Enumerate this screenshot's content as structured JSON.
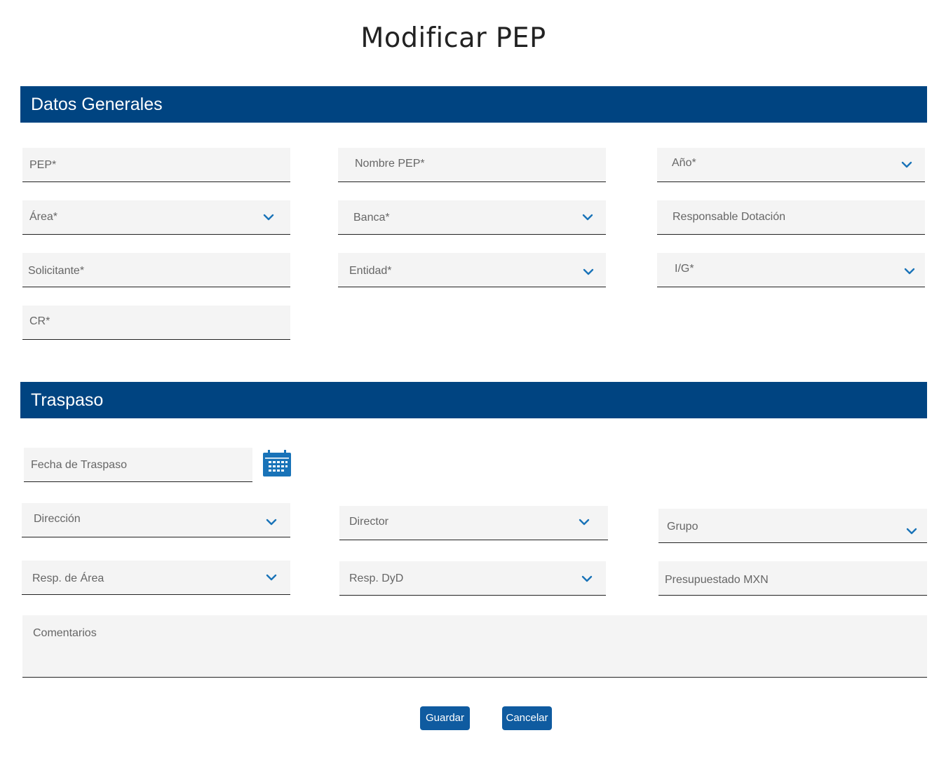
{
  "title": "Modificar  PEP",
  "sections": {
    "general": "Datos Generales",
    "transfer": "Traspaso"
  },
  "fields": {
    "pep": "PEP*",
    "nombre_pep": "Nombre PEP*",
    "anio": "Año*",
    "area": "Área*",
    "banca": "Banca*",
    "responsable_dotacion": "Responsable Dotación",
    "solicitante": "Solicitante*",
    "entidad": "Entidad*",
    "ig": "I/G*",
    "cr": "CR*",
    "fecha_traspaso": "Fecha de Traspaso",
    "direccion": "Dirección",
    "director": "Director",
    "grupo": "Grupo",
    "resp_area": "Resp. de Área",
    "resp_dyd": "Resp. DyD",
    "presupuestado": "Presupuestado MXN",
    "comentarios": "Comentarios"
  },
  "buttons": {
    "save": "Guardar",
    "cancel": "Cancelar"
  },
  "icons": {
    "dropdown": "chevron-down-icon",
    "calendar": "calendar-icon"
  },
  "colors": {
    "header_bar": "#004481",
    "accent": "#1973b8",
    "button": "#0f5ba0",
    "field_bg": "#f4f4f4"
  }
}
